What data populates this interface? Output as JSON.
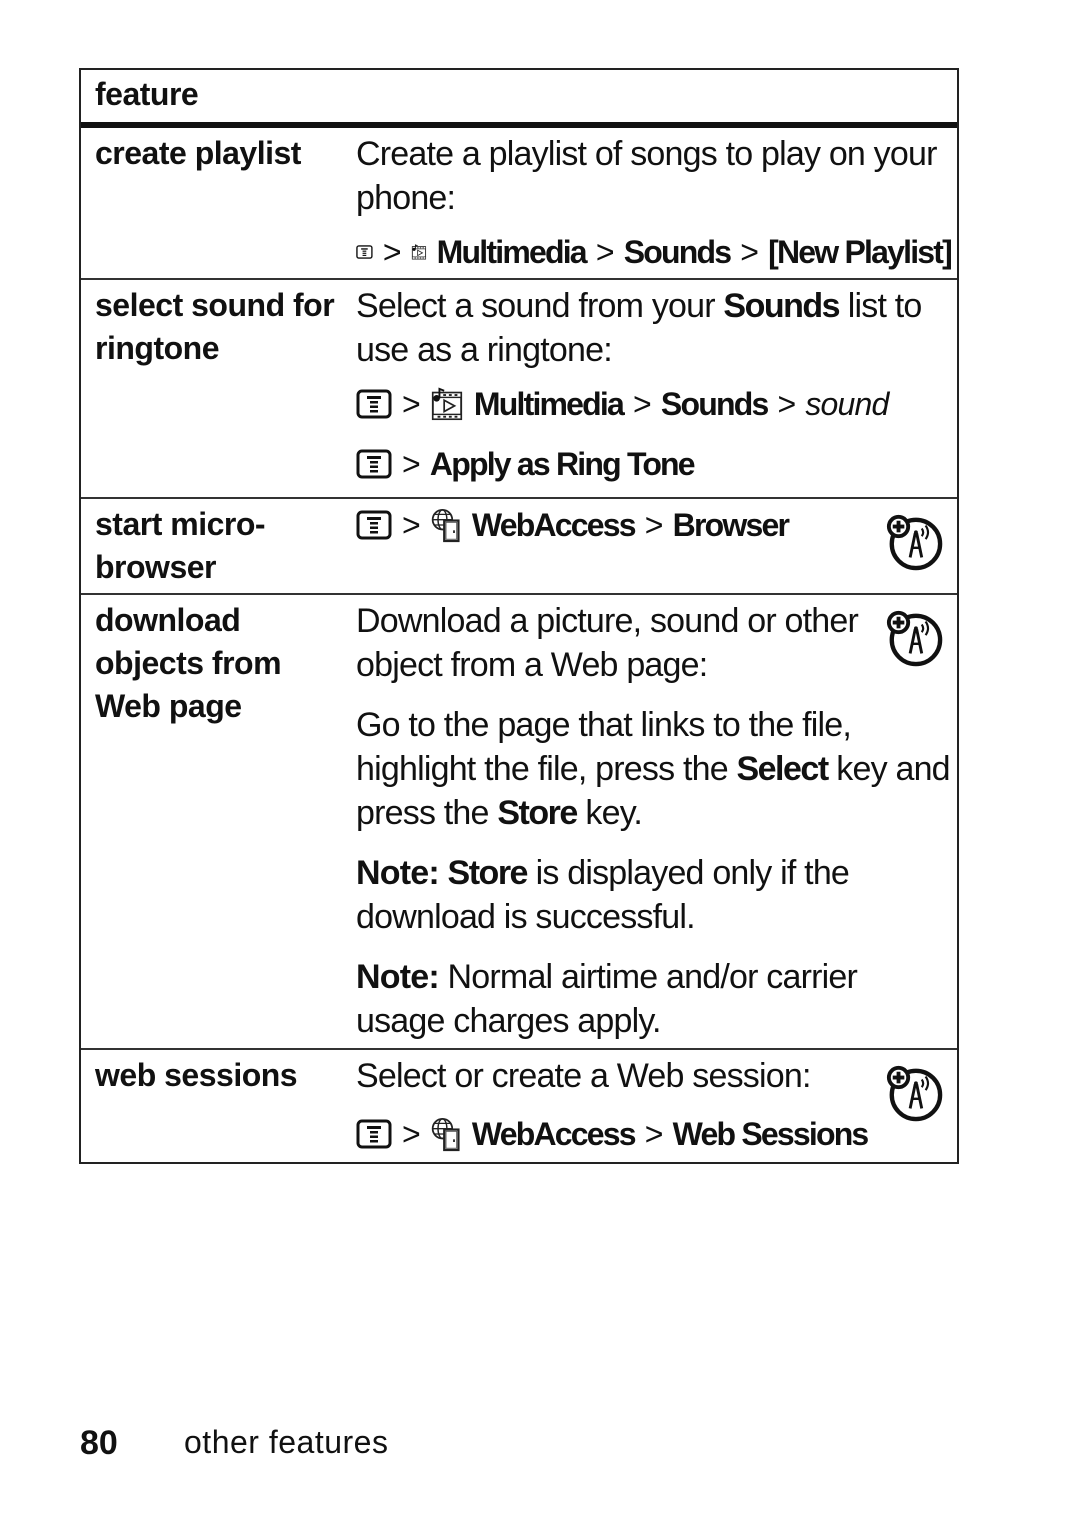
{
  "table": {
    "header": "feature",
    "rows": [
      {
        "feature": "create playlist",
        "description": "Create a playlist of songs to play on your phone:",
        "path": {
          "sep": ">",
          "items": [
            "Multimedia",
            "Sounds",
            "[New Playlist]"
          ],
          "icons": [
            "menu-key-icon",
            "multimedia-icon"
          ]
        }
      },
      {
        "feature": "select sound for ringtone",
        "description_parts": [
          "Select a sound from your ",
          "Sounds",
          " list to use as a ringtone:"
        ],
        "path1": {
          "items": [
            "Multimedia",
            "Sounds"
          ],
          "italic": "sound",
          "icons": [
            "menu-key-icon",
            "multimedia-icon"
          ]
        },
        "path2": {
          "items": [
            "Apply as Ring Tone"
          ],
          "icons": [
            "menu-key-icon"
          ]
        }
      },
      {
        "feature": "start micro-browser",
        "path": {
          "items": [
            "WebAccess",
            "Browser"
          ],
          "icons": [
            "menu-key-icon",
            "webaccess-icon"
          ]
        },
        "badge": "network-dependent-icon"
      },
      {
        "feature": "download objects from Web page",
        "description": "Download a picture, sound or other object from a Web page:",
        "step_parts": [
          "Go to the page that links to the file, highlight the file, press the ",
          "Select",
          " key and press the ",
          "Store",
          " key."
        ],
        "note1": {
          "label": "Note:",
          "key": "Store",
          "text": " is displayed only if the download is successful."
        },
        "note2": {
          "label": "Note:",
          "text": " Normal airtime and/or carrier usage charges apply."
        },
        "badge": "network-dependent-icon"
      },
      {
        "feature": "web sessions",
        "description": "Select or create a Web session:",
        "path": {
          "items": [
            "WebAccess",
            "Web Sessions"
          ],
          "icons": [
            "menu-key-icon",
            "webaccess-icon"
          ]
        },
        "badge": "network-dependent-icon"
      }
    ]
  },
  "footer": {
    "page_number": "80",
    "section": "other features"
  },
  "sep": ">"
}
